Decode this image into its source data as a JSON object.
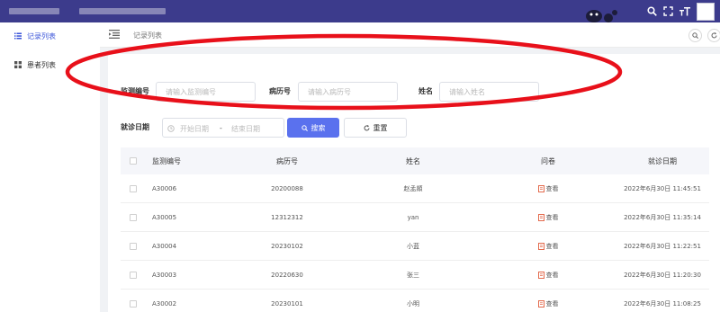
{
  "colors": {
    "topbar": "#3c3b8c",
    "accent": "#3b55d9",
    "primary_button": "#5a71ee",
    "annotation": "#e8101a"
  },
  "topbar": {
    "icons": [
      "search-icon",
      "fullscreen-icon",
      "font-size-icon",
      "avatar"
    ]
  },
  "sidebar": {
    "items": [
      {
        "label": "记录列表",
        "icon": "list-icon",
        "active": true
      },
      {
        "label": "患者列表",
        "icon": "grid-icon",
        "active": false
      }
    ]
  },
  "breadcrumb": {
    "current": "记录列表"
  },
  "search_form": {
    "monitor_no": {
      "label": "监测编号",
      "placeholder": "请输入监测编号"
    },
    "record_no": {
      "label": "病历号",
      "placeholder": "请输入病历号"
    },
    "name": {
      "label": "姓名",
      "placeholder": "请输入姓名"
    },
    "visit_date": {
      "label": "就诊日期",
      "start_placeholder": "开始日期",
      "separator": "-",
      "end_placeholder": "结束日期"
    },
    "search_button": "搜索",
    "reset_button": "重置"
  },
  "table": {
    "headers": [
      "监测编号",
      "病历号",
      "姓名",
      "问卷",
      "就诊日期"
    ],
    "rows": [
      {
        "monitor_no": "A30006",
        "record_no": "20200088",
        "name": "赵孟頫",
        "questionnaire": "查看",
        "date": "2022年6月30日 11:45:51"
      },
      {
        "monitor_no": "A30005",
        "record_no": "12312312",
        "name": "yan",
        "questionnaire": "查看",
        "date": "2022年6月30日 11:35:14"
      },
      {
        "monitor_no": "A30004",
        "record_no": "20230102",
        "name": "小蓝",
        "questionnaire": "查看",
        "date": "2022年6月30日 11:22:51"
      },
      {
        "monitor_no": "A30003",
        "record_no": "20220630",
        "name": "张三",
        "questionnaire": "查看",
        "date": "2022年6月30日 11:20:30"
      },
      {
        "monitor_no": "A30002",
        "record_no": "20230101",
        "name": "小明",
        "questionnaire": "查看",
        "date": "2022年6月30日 11:08:25"
      }
    ]
  }
}
